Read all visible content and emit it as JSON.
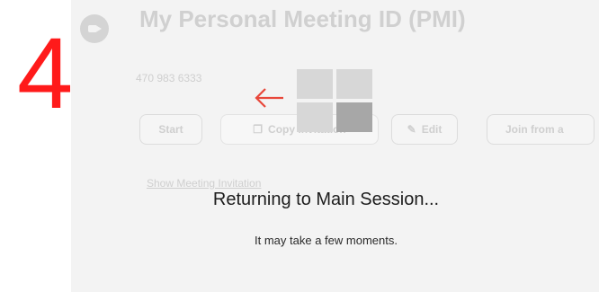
{
  "step_label": "4",
  "meeting_page": {
    "title": "My Personal Meeting ID (PMI)",
    "pmi_number": "470 983 6333",
    "buttons": {
      "start": "Start",
      "copy": "Copy Invitation",
      "edit": "Edit",
      "join": "Join from a"
    },
    "show_invitation": "Show Meeting Invitation"
  },
  "overlay": {
    "message": "Returning to Main Session...",
    "submessage": "It may take a few moments."
  },
  "colors": {
    "step_number": "#ff1a1a",
    "arrow": "#e8473a",
    "background": "#f3f3f3"
  },
  "icons": {
    "arrow": "arrow-left-icon",
    "rooms": "breakout-rooms-icon",
    "camera": "video-camera-icon",
    "copy": "copy-icon",
    "edit": "pencil-icon"
  }
}
